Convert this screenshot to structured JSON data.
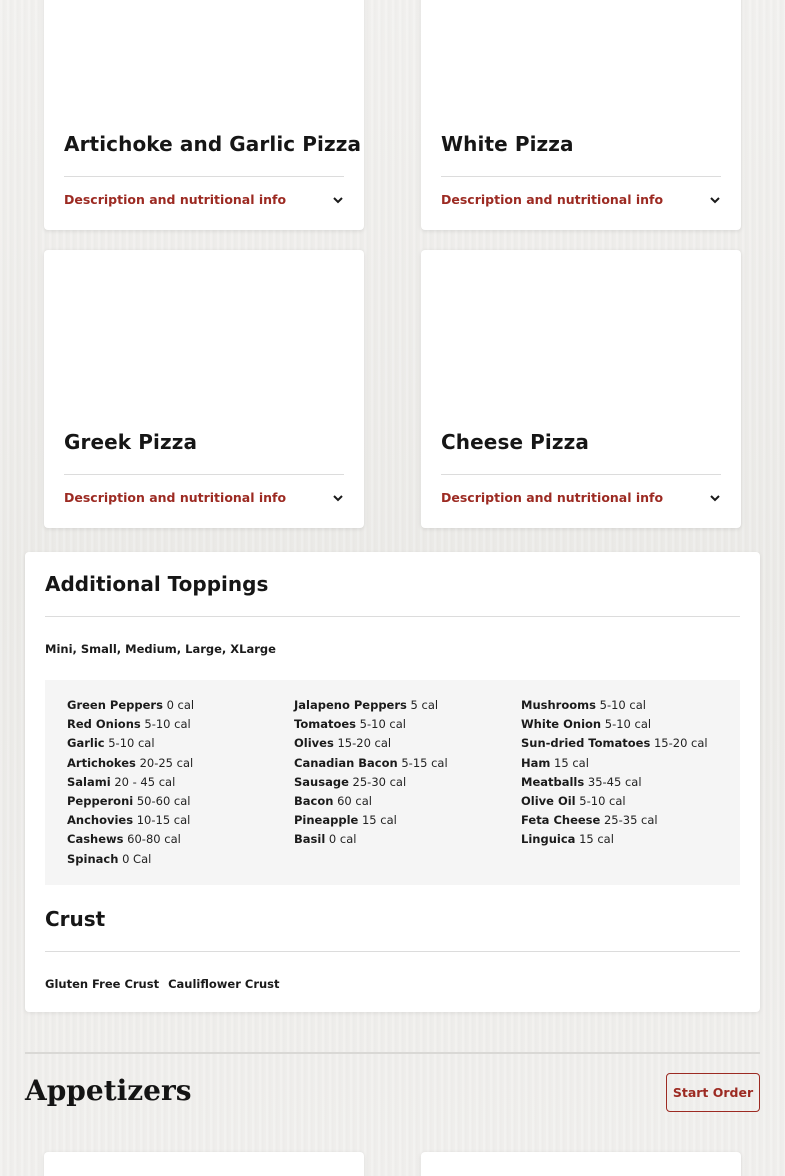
{
  "pizzas": [
    {
      "name": "Artichoke and Garlic Pizza",
      "desc_label": "Description and nutritional info"
    },
    {
      "name": "White Pizza",
      "desc_label": "Description and nutritional info"
    },
    {
      "name": "Greek Pizza",
      "desc_label": "Description and nutritional info"
    },
    {
      "name": "Cheese Pizza",
      "desc_label": "Description and nutritional info"
    }
  ],
  "toppings": {
    "title": "Additional Toppings",
    "sizes": "Mini, Small, Medium, Large, XLarge",
    "columns": [
      [
        {
          "name": "Green Peppers",
          "cal": "0 cal"
        },
        {
          "name": "Red Onions",
          "cal": "5-10 cal"
        },
        {
          "name": "Garlic",
          "cal": "5-10 cal"
        },
        {
          "name": "Artichokes",
          "cal": "20-25 cal"
        },
        {
          "name": "Salami",
          "cal": "20 - 45 cal"
        },
        {
          "name": "Pepperoni",
          "cal": "50-60 cal"
        },
        {
          "name": "Anchovies",
          "cal": "10-15 cal"
        },
        {
          "name": "Cashews",
          "cal": "60-80 cal"
        },
        {
          "name": "Spinach",
          "cal": "0 Cal"
        }
      ],
      [
        {
          "name": "Jalapeno Peppers",
          "cal": "5 cal"
        },
        {
          "name": "Tomatoes",
          "cal": "5-10 cal"
        },
        {
          "name": "Olives",
          "cal": "15-20 cal"
        },
        {
          "name": "Canadian Bacon",
          "cal": "5-15 cal"
        },
        {
          "name": "Sausage",
          "cal": "25-30 cal"
        },
        {
          "name": "Bacon",
          "cal": "60 cal"
        },
        {
          "name": "Pineapple",
          "cal": "15 cal"
        },
        {
          "name": "Basil",
          "cal": "0 cal"
        }
      ],
      [
        {
          "name": "Mushrooms",
          "cal": "5-10 cal"
        },
        {
          "name": "White Onion",
          "cal": "5-10 cal"
        },
        {
          "name": "Sun-dried Tomatoes",
          "cal": "15-20 cal"
        },
        {
          "name": "Ham",
          "cal": "15 cal"
        },
        {
          "name": "Meatballs",
          "cal": "35-45 cal"
        },
        {
          "name": "Olive Oil",
          "cal": "5-10 cal"
        },
        {
          "name": "Feta Cheese",
          "cal": "25-35 cal"
        },
        {
          "name": "Linguica",
          "cal": "15 cal"
        }
      ]
    ]
  },
  "crust": {
    "title": "Crust",
    "options": [
      "Gluten Free Crust",
      "Cauliflower Crust"
    ]
  },
  "appetizers": {
    "title": "Appetizers",
    "start_order_label": "Start Order"
  },
  "colors": {
    "accent": "#9c2a22",
    "card_bg": "#ffffff",
    "toppings_bg": "#f5f5f5"
  },
  "icons": {
    "expand": "chevron-down-icon"
  }
}
